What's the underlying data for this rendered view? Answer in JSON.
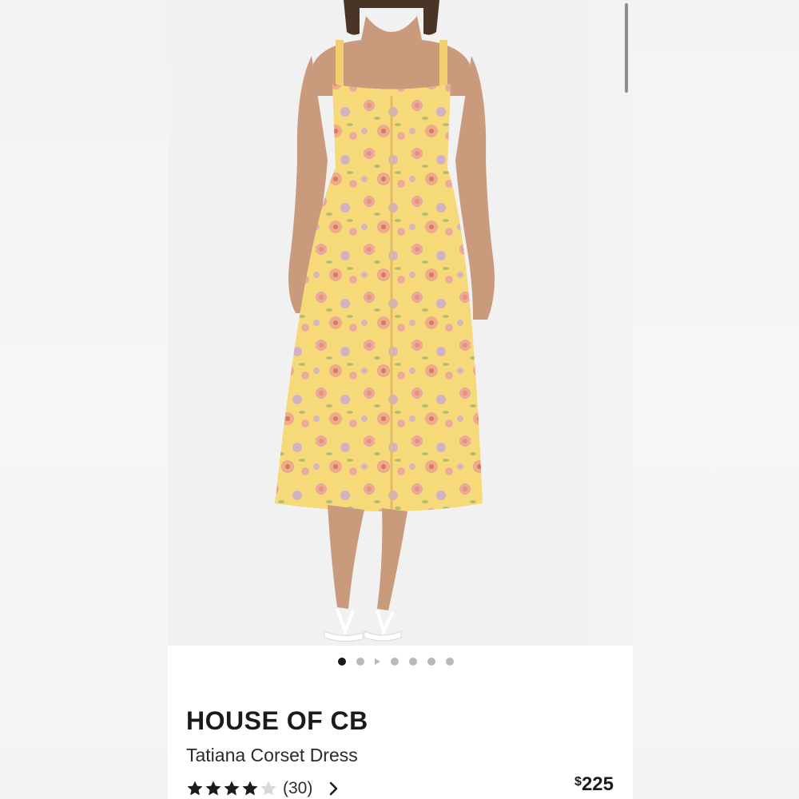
{
  "gallery": {
    "image_alt": "Model wearing a yellow floral corset midi dress with button front",
    "dots_total": 7,
    "active_index": 0,
    "video_index": 2
  },
  "product": {
    "brand": "HOUSE OF CB",
    "name": "Tatiana Corset Dress",
    "rating": 4,
    "rating_max": 5,
    "review_count": "(30)",
    "price_currency": "$",
    "price_amount": "225"
  },
  "colors": {
    "dress_base": "#f6da7a",
    "flower_pink": "#e9a0a8",
    "flower_orange": "#e8956b",
    "flower_lilac": "#c8a7d8",
    "text": "#1b1b1b",
    "dot_active": "#1a1a1a",
    "dot_inactive": "#b9b9b9"
  },
  "icons": {
    "star_full": "star-icon",
    "star_empty": "star-empty-icon",
    "chevron": "chevron-right-icon",
    "video": "play-icon"
  }
}
